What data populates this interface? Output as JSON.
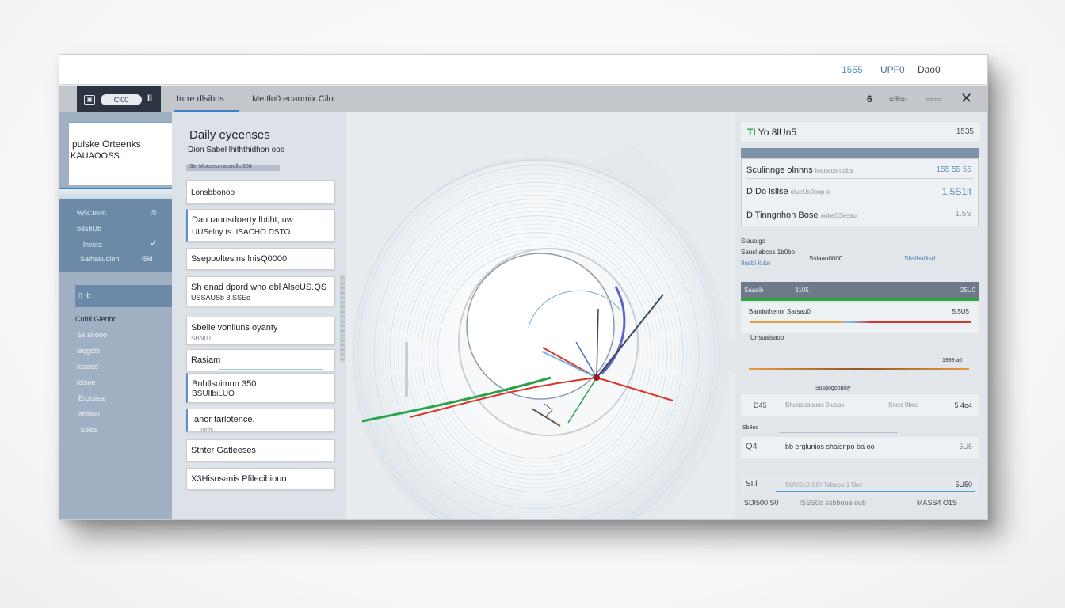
{
  "topbar": {
    "num": "1555",
    "update": "UPF0",
    "user": "Dao0"
  },
  "toolbar": {
    "logo": "▣",
    "pill": "Cl00",
    "pause": "II",
    "tab1": "Inrre dlsibos",
    "tab2": "Mettlo0 eoanmix.Cilo",
    "right1": "6",
    "right2": "≡⊞≡·",
    "right3": "≡≡≡≡",
    "close": "✕"
  },
  "sidebar": {
    "card_title": "pulske Orteenks",
    "card_sub": "KAUAOOSS .",
    "nav": [
      {
        "label": "%5Ctaun",
        "icon": "◎"
      },
      {
        "label": "b8shUb"
      },
      {
        "label": "lnvsra",
        "icon": "✓"
      },
      {
        "label": "Salhasuoion",
        "value": "l5kl"
      }
    ],
    "selected": "▯ ·b .",
    "list": [
      "Cuhtl Glenbo",
      "Ss anooo",
      "laqgolb",
      "leaaod",
      "lolsoe",
      "Erotsiea",
      "abibuu",
      "Sblbs"
    ]
  },
  "listpanel": {
    "title": "Daily eyeenses",
    "subtitle": "Dion Sabel lhiththidhon oos",
    "filter": "Sel Mocdeon aboolls 30d",
    "items": [
      {
        "a": "Lonsbbonoo",
        "b": ""
      },
      {
        "a": "Dan raonsdoerty lbtiht, uw",
        "b": "UUSelny  ts. ISACHO DSTO"
      },
      {
        "a": "Sseppoltesins  lnisQ0000",
        "b": ""
      },
      {
        "a": "Sh enad dpord who  ebl  AlseUS.QS",
        "b": "USSAUSb 3.SSEo"
      },
      {
        "a": "Sbelle vonliuns oyanty",
        "b": "SBN0    l."
      },
      {
        "a": "Rasiam",
        "b": ""
      },
      {
        "a": "Bnbllsoimno   350",
        "b": "BSUIlbiLUO"
      },
      {
        "a": "Ianor tarlotence.",
        "b": "Tonbl"
      },
      {
        "a": "Stnter  Gatleeses",
        "b": ""
      },
      {
        "a": "X3Hisnsanis  Pfilecibiouo",
        "b": ""
      }
    ]
  },
  "rightpanel": {
    "header_icon": "TI",
    "header_label": "Yo  8lUn5",
    "header_value": "1535",
    "rows": [
      {
        "label": "Sculinnge olnnns",
        "sub": "loanaos oobs",
        "value": "155 55 55"
      },
      {
        "label": "D Do lsllse",
        "sub": "olueUs0oop o",
        "value": "1.5S1lt"
      },
      {
        "label": "D Tinngnhon Bose",
        "sub": "oobeSSesso",
        "value": "1.5S"
      }
    ],
    "section": {
      "l1": "Slauoigs",
      "l2": "Sausl  abcos  1b0bo",
      "l3": "8usbi lo&n",
      "l4": "Sslaao0000",
      "l5": "Sbslbu0isd"
    },
    "table_header": {
      "left": "Saasib",
      "mid": "3105",
      "right": "25U0"
    },
    "progress": {
      "label": "Banduthenor Sarsau0",
      "value": "5.5U5",
      "fraction": 1.0
    },
    "mini1": "Unsualsaoo",
    "mini2": "1999  a0",
    "mini3": "Susgogoopluy",
    "row_a": {
      "l": "D45",
      "m": "Bhaosoabuos 0lusos",
      "r": "Snoo 0bos",
      "v": "5 4o4"
    },
    "row_b_head": "Sb8eo",
    "row_b": {
      "l": "Q4",
      "m": "bb erglunios shaisnpo  ba oo",
      "v": "5U5"
    },
    "row_c": {
      "l": "SI.l",
      "m": "SUUSo0 SSI  Tabooo  1  5bo",
      "v": "5U50"
    },
    "footer": {
      "l": "SDI500 S0",
      "m": "lSSS0o ssbboue  oub",
      "r": "MASS4 O1S"
    }
  },
  "colors": {
    "accent": "#3e7fc4",
    "green": "#2aa24a",
    "red": "#d9362b",
    "orange": "#e69b3b"
  }
}
